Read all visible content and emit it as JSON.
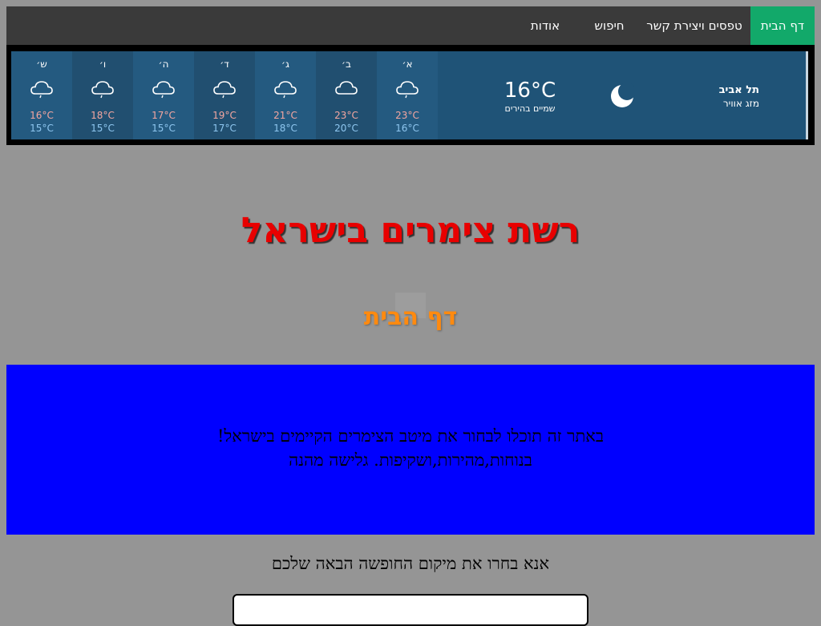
{
  "nav": {
    "items": [
      {
        "label": "דף הבית",
        "active": true
      },
      {
        "label": "טפסים ויצירת קשר",
        "active": false
      },
      {
        "label": "חיפוש",
        "active": false
      },
      {
        "label": "אודות",
        "active": false
      }
    ]
  },
  "weather": {
    "city": "תל אביב",
    "label": "מזג אוויר",
    "current_temp": "16°C",
    "current_condition": "שמיים בהירים",
    "current_icon": "moon-icon",
    "days": [
      {
        "name": "א׳",
        "high": "23°C",
        "low": "16°C",
        "icon": "cloud-rain-icon"
      },
      {
        "name": "ב׳",
        "high": "23°C",
        "low": "20°C",
        "icon": "cloud-icon"
      },
      {
        "name": "ג׳",
        "high": "21°C",
        "low": "18°C",
        "icon": "cloud-rain-icon"
      },
      {
        "name": "ד׳",
        "high": "19°C",
        "low": "17°C",
        "icon": "cloud-rain-icon"
      },
      {
        "name": "ה׳",
        "high": "17°C",
        "low": "15°C",
        "icon": "cloud-rain-icon"
      },
      {
        "name": "ו׳",
        "high": "18°C",
        "low": "15°C",
        "icon": "cloud-rain-icon"
      },
      {
        "name": "ש׳",
        "high": "16°C",
        "low": "15°C",
        "icon": "cloud-rain-icon"
      }
    ]
  },
  "header": {
    "site_title": "רשת צימרים בישראל",
    "page_subtitle": "דף הבית"
  },
  "intro": {
    "line1": "באתר זה תוכלו לבחור את מיטב הצימרים הקיימים בישראל!",
    "line2": "בנוחות,מהירות,ושקיפות. גלישה מהנה"
  },
  "choose": {
    "label": "אנא בחרו את מיקום החופשה הבאה שלכם"
  },
  "colors": {
    "nav_bg": "#3a3a3a",
    "nav_active": "#12a96a",
    "weather_bg": "#1f5377",
    "title_red": "#e80000",
    "subtitle_orange": "#ff8a0f",
    "intro_blue": "#0000ff"
  }
}
